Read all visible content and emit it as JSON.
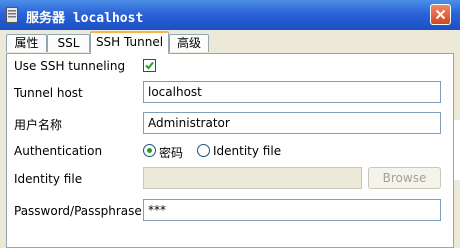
{
  "window": {
    "title": "服务器 localhost",
    "close_icon": "close-icon",
    "app_icon": "server-icon"
  },
  "tabs": [
    {
      "label": "属性",
      "active": false
    },
    {
      "label": "SSL",
      "active": false
    },
    {
      "label": "SSH Tunnel",
      "active": true
    },
    {
      "label": "高级",
      "active": false
    }
  ],
  "form": {
    "use_ssh_label": "Use SSH tunneling",
    "use_ssh_checked": true,
    "tunnel_host_label": "Tunnel host",
    "tunnel_host_value": "localhost",
    "username_label": "用户名称",
    "username_value": "Administrator",
    "auth_label": "Authentication",
    "auth_option_password": "密码",
    "auth_option_identity": "Identity file",
    "auth_selected": "密码",
    "identity_label": "Identity file",
    "identity_value": "",
    "browse_label": "Browse",
    "password_label": "Password/Passphrase",
    "password_value": "***"
  },
  "colors": {
    "title_bar": "#2a63d8",
    "active_tab_accent": "#f8b34c",
    "check": "#21a121"
  }
}
